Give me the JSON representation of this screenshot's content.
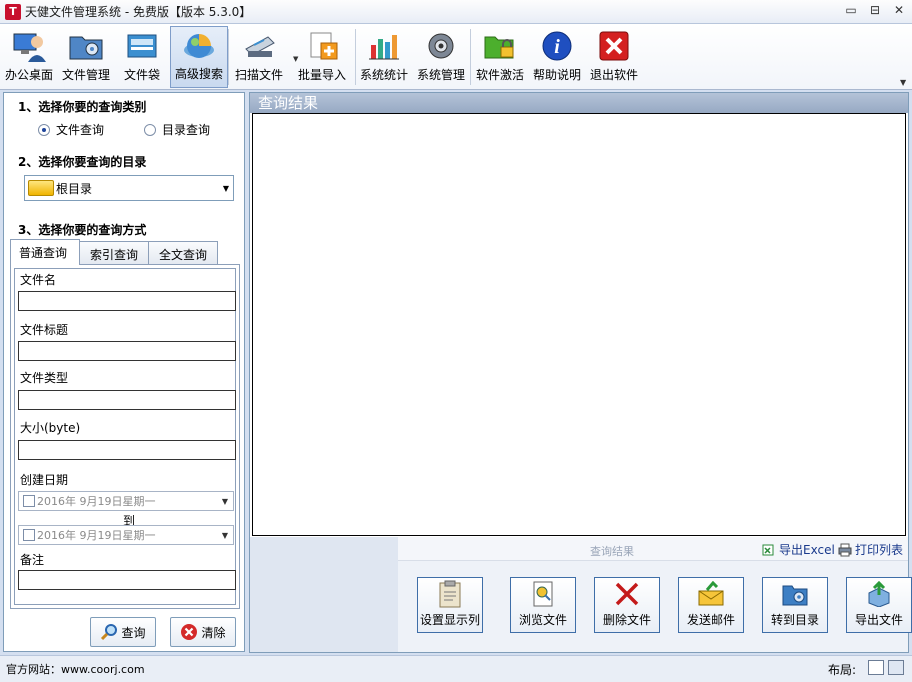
{
  "window": {
    "logo_char": "T",
    "title": "天健文件管理系统 - 免费版【版本 5.3.0】",
    "min": "▭",
    "restore": "⊟",
    "close": "✕"
  },
  "toolbar": {
    "office_desktop": "办公桌面",
    "file_manage": "文件管理",
    "file_bag": "文件袋",
    "advanced_search": "高级搜索",
    "scan_file": "扫描文件",
    "batch_import": "批量导入",
    "sys_stats": "系统统计",
    "sys_manage": "系统管理",
    "activate": "软件激活",
    "help": "帮助说明",
    "exit": "退出软件"
  },
  "left": {
    "step1_title": "1、选择你要的查询类别",
    "radio_file": "文件查询",
    "radio_dir": "目录查询",
    "step2_title": "2、选择你要查询的目录",
    "dir_value": "根目录",
    "step3_title": "3、选择你要的查询方式",
    "tabs": [
      "普通查询",
      "索引查询",
      "全文查询"
    ],
    "fields": {
      "file_name": "文件名",
      "file_title": "文件标题",
      "file_type": "文件类型",
      "size": "大小(byte)",
      "create_date": "创建日期",
      "date_from": "2016年  9月19日星期一",
      "to": "到",
      "date_to": "2016年  9月19日星期一",
      "remark": "备注"
    },
    "query_btn": "查询",
    "clear_btn": "清除"
  },
  "right": {
    "header": "查询结果",
    "bottom_title": "查询结果",
    "export_excel": "导出Excel",
    "print_list": "打印列表",
    "buttons": {
      "set_columns": "设置显示列",
      "browse_file": "浏览文件",
      "delete_file": "删除文件",
      "send_mail": "发送邮件",
      "goto_dir": "转到目录",
      "export_file": "导出文件"
    }
  },
  "status": {
    "website": "官方网站：www.coorj.com",
    "layout": "布局:"
  }
}
